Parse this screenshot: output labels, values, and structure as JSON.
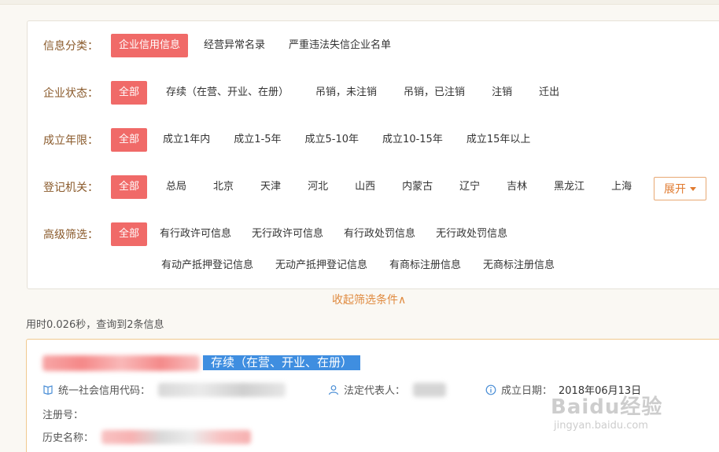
{
  "filters": {
    "category": {
      "label": "信息分类：",
      "options": [
        "企业信用信息",
        "经营异常名录",
        "严重违法失信企业名单"
      ],
      "active": 0
    },
    "status": {
      "label": "企业状态：",
      "options": [
        "全部",
        "存续（在营、开业、在册）",
        "吊销，未注销",
        "吊销，已注销",
        "注销",
        "迁出"
      ],
      "active": 0
    },
    "age": {
      "label": "成立年限：",
      "options": [
        "全部",
        "成立1年内",
        "成立1-5年",
        "成立5-10年",
        "成立10-15年",
        "成立15年以上"
      ],
      "active": 0
    },
    "authority": {
      "label": "登记机关：",
      "options": [
        "全部",
        "总局",
        "北京",
        "天津",
        "河北",
        "山西",
        "内蒙古",
        "辽宁",
        "吉林",
        "黑龙江",
        "上海"
      ],
      "active": 0,
      "expand_label": "展开"
    },
    "advanced": {
      "label": "高级筛选：",
      "options": [
        "全部",
        "有行政许可信息",
        "无行政许可信息",
        "有行政处罚信息",
        "无行政处罚信息"
      ],
      "options_row2": [
        "有动产抵押登记信息",
        "无动产抵押登记信息",
        "有商标注册信息",
        "无商标注册信息"
      ],
      "active": 0
    },
    "collapse_label": "收起筛选条件∧"
  },
  "stats": "用时0.026秒，查询到2条信息",
  "result": {
    "status_tag": "存续（在营、开业、在册）",
    "credit_code_label": "统一社会信用代码：",
    "legal_rep_label": "法定代表人：",
    "founded_label": "成立日期：",
    "founded_value": "2018年06月13日",
    "reg_no_label": "注册号：",
    "former_name_label": "历史名称："
  },
  "watermark": {
    "logo": "Baidu经验",
    "url": "jingyan.baidu.com"
  },
  "colors": {
    "active_bg": "#f06a68",
    "label": "#8a5a2b",
    "accent": "#e07a2f",
    "status_tag": "#3f8ee0"
  }
}
